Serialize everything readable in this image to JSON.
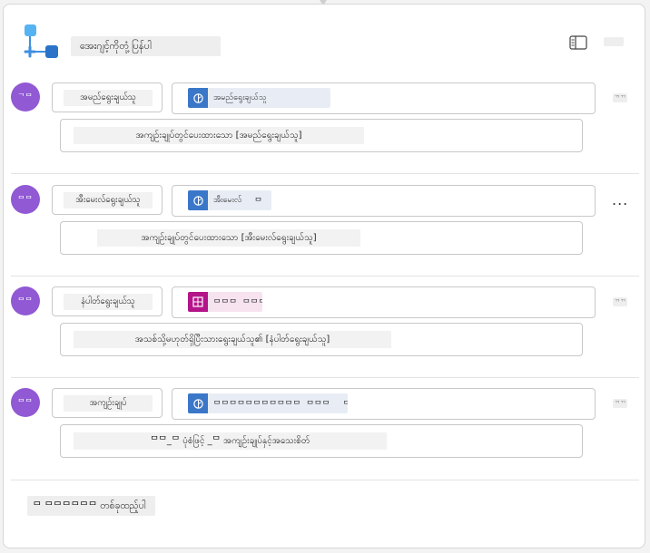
{
  "header": {
    "title": "အေးဂျင့်ကိုတုံ့ပြန်ပါ",
    "flow_icon": "flow-diagram-icon",
    "panel_icon": "side-panel-icon",
    "colors": {
      "flow_icon": "#3d8fe0",
      "accent": "#9159d4"
    }
  },
  "steps": [
    {
      "avatar_text": "ᄀᄆ",
      "key": "အမည်ရွေးချယ်သူ",
      "token_icon": "brain-circuit-icon",
      "token_text": "အမည်ရွေးချယ်သူ",
      "token_suffix": "",
      "row_end": "ᄁᄁ",
      "description": "အကျဉ်းချုပ်တွင်ပေးထားသော [အမည်ရွေးချယ်သူ]"
    },
    {
      "avatar_text": "ᄆᄆ",
      "key": "အီးမေးလ်ရွေးချယ်သူ",
      "token_icon": "brain-circuit-icon",
      "token_text": "အီးမေးလ်",
      "token_suffix": "ᄆ",
      "row_end": "...",
      "description": "အကျဉ်းချုပ်တွင်ပေးထားသော [အီးမေးလ်ရွေးချယ်သူ]"
    },
    {
      "avatar_text": "ᄆᄆ",
      "key": "နံပါတ်ရွေးချယ်သူ",
      "token_icon": "table-icon",
      "token_text": "ᄆᄆᄆ ᄆᄆᄆ",
      "token_suffix": "",
      "row_end": "ᄁᄁ",
      "description": "အသစ်သို့မဟုတ်ရှိပြီးသားရွေးချယ်သူ၏ [နံပါတ်ရွေးချယ်သူ]"
    },
    {
      "avatar_text": "ᄆᄆ",
      "key": "အကျဉ်းချုပ်",
      "token_icon": "brain-circuit-icon",
      "token_text": "ᄆᄆᄆᄆᄆᄆᄆᄆᄆᄆᄆ ᄆᄆᄆ",
      "token_suffix": "ᄆ",
      "row_end": "ᄁᄁ",
      "description": "ᄆᄆ_ᄆ ပုံစံဖြင့် _ᄆ အကျဉ်းချုပ်နှင့်အသေးစိတ်"
    }
  ],
  "add_button_label": "ᄆ ᄆᄆᄆᄆᄆᄆ တစ်ခုထည့်ပါ"
}
